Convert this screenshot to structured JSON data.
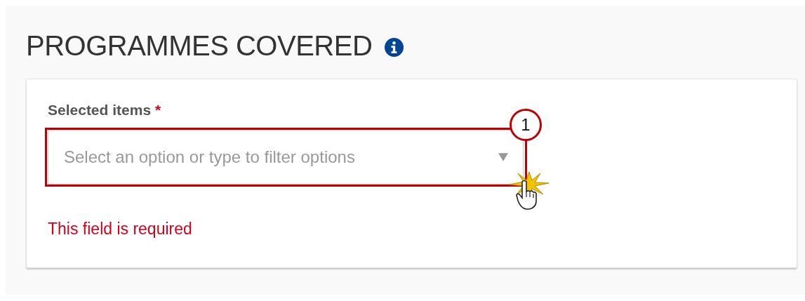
{
  "section": {
    "title": "PROGRAMMES COVERED"
  },
  "field": {
    "label": "Selected items",
    "required_mark": "*",
    "placeholder": "Select an option or type to filter options",
    "error": "This field is required"
  },
  "annotation": {
    "callout": "1"
  }
}
